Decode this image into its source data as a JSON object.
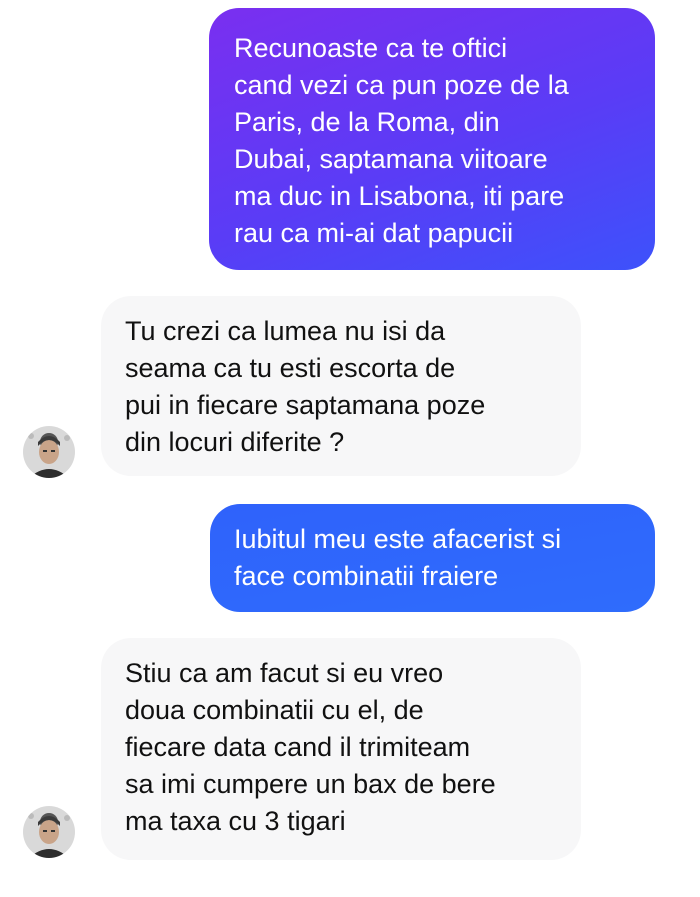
{
  "conversation": {
    "messages": [
      {
        "sender": "me",
        "text": "Recunoaste ca te oftici\ncand vezi ca pun poze de la\nParis, de la Roma, din\nDubai, saptamana viitoare\nma duc in Lisabona, iti pare\nrau ca mi-ai dat papucii"
      },
      {
        "sender": "contact",
        "text": "Tu crezi ca lumea nu isi da\nseama ca tu esti escorta de\npui in fiecare saptamana poze\ndin locuri diferite ?"
      },
      {
        "sender": "me",
        "text": "Iubitul meu este afacerist si\nface combinatii fraiere"
      },
      {
        "sender": "contact",
        "text": "Stiu      ca am facut si eu vreo\ndoua combinatii cu el, de\nfiecare data cand il trimiteam\nsa imi cumpere un bax de bere\nma taxa cu 3 tigari"
      }
    ]
  },
  "colors": {
    "sent_gradient_start": "#7a2ff0",
    "sent_gradient_end": "#3d52fb",
    "sent_solid": "#2f66fb",
    "received_background": "#f7f7f8",
    "received_text": "#111111"
  }
}
